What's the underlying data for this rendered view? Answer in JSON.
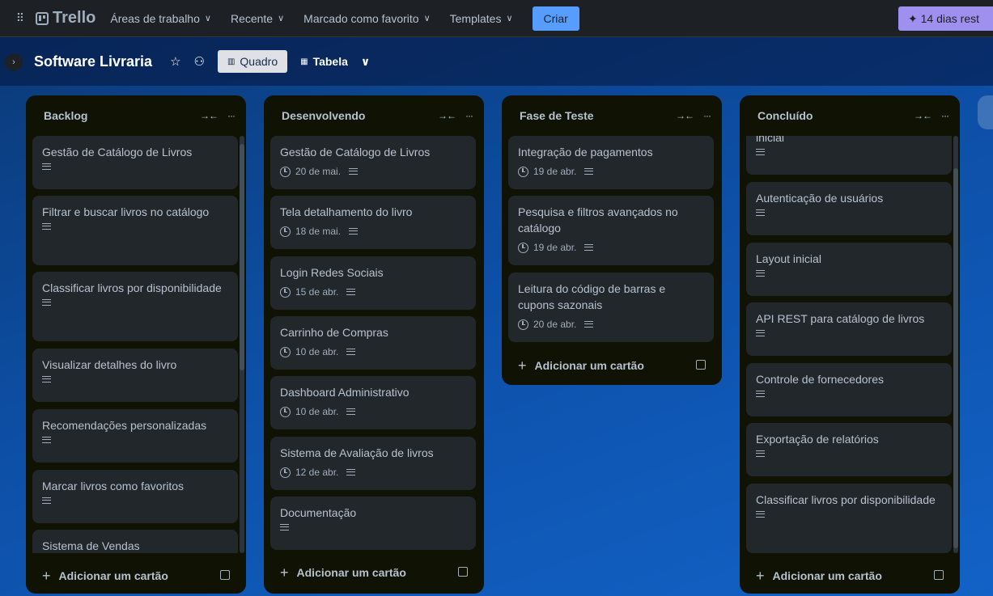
{
  "nav": {
    "logo": "Trello",
    "items": [
      "Áreas de trabalho",
      "Recente",
      "Marcado como favorito",
      "Templates"
    ],
    "create": "Criar",
    "trial": "✦ 14 dias rest"
  },
  "board": {
    "title": "Software Livraria",
    "views": [
      "Quadro",
      "Tabela"
    ]
  },
  "add_card": "Adicionar um cartão",
  "lists": [
    {
      "title": "Backlog",
      "cards": [
        {
          "title": "Gestão de Catálogo de Livros",
          "date": ""
        },
        {
          "title": "Filtrar e buscar livros no catálogo",
          "date": ""
        },
        {
          "title": "Classificar livros por disponibilidade",
          "date": ""
        },
        {
          "title": "Visualizar detalhes do livro",
          "date": ""
        },
        {
          "title": "Recomendações personalizadas",
          "date": ""
        },
        {
          "title": "Marcar livros como favoritos",
          "date": ""
        },
        {
          "title": "Sistema de Vendas",
          "date": ""
        }
      ]
    },
    {
      "title": "Desenvolvendo",
      "cards": [
        {
          "title": "Gestão de Catálogo de Livros",
          "date": "20 de mai."
        },
        {
          "title": "Tela detalhamento do livro",
          "date": "18 de mai."
        },
        {
          "title": "Login Redes Sociais",
          "date": "15 de abr."
        },
        {
          "title": "Carrinho de Compras",
          "date": "10 de abr."
        },
        {
          "title": "Dashboard Administrativo",
          "date": "10 de abr."
        },
        {
          "title": "Sistema de Avaliação de livros",
          "date": "12 de abr."
        },
        {
          "title": "Documentação",
          "date": ""
        }
      ]
    },
    {
      "title": "Fase de Teste",
      "cards": [
        {
          "title": "Integração de pagamentos",
          "date": "19 de abr."
        },
        {
          "title": "Pesquisa e filtros avançados no catálogo",
          "date": "19 de abr."
        },
        {
          "title": "Leitura do código de barras e cupons sazonais",
          "date": "20 de abr."
        }
      ]
    },
    {
      "title": "Concluído",
      "cards": [
        {
          "title": "inicial",
          "date": ""
        },
        {
          "title": "Autenticação de usuários",
          "date": ""
        },
        {
          "title": "Layout inicial",
          "date": ""
        },
        {
          "title": "API REST para catálogo de livros",
          "date": ""
        },
        {
          "title": "Controle de fornecedores",
          "date": ""
        },
        {
          "title": "Exportação de relatórios",
          "date": ""
        },
        {
          "title": "Classificar livros por disponibilidade",
          "date": ""
        }
      ]
    }
  ]
}
